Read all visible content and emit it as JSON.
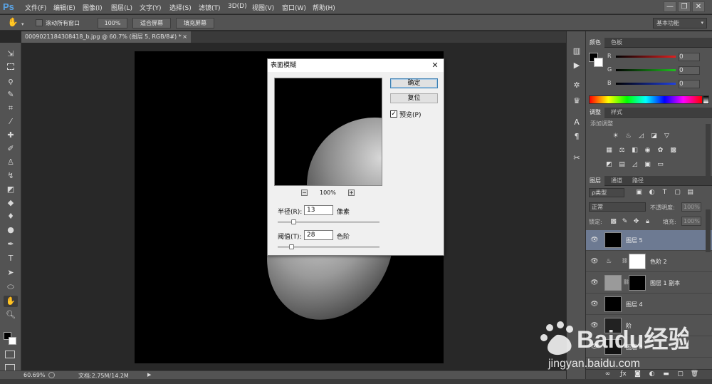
{
  "app": {
    "logo": "Ps"
  },
  "menubar": {
    "items": [
      "文件(F)",
      "编辑(E)",
      "图像(I)",
      "图层(L)",
      "文字(Y)",
      "选择(S)",
      "滤镜(T)",
      "3D(D)",
      "视图(V)",
      "窗口(W)",
      "帮助(H)"
    ],
    "window_buttons": [
      "—",
      "❐",
      "✕"
    ]
  },
  "options": {
    "scroll_all_label": "滚动所有窗口",
    "zoom_100_label": "100%",
    "fit_screen_label": "适合屏幕",
    "fill_screen_label": "填充屏幕",
    "workspace": "基本功能"
  },
  "document": {
    "tab_title": "0009021184308418_b.jpg @ 60.7% (图层 5, RGB/8#) *",
    "tab_close": "×"
  },
  "status": {
    "zoom": "60.69%",
    "doc_info": "文档:2.75M/14.2M"
  },
  "color_panel": {
    "tabs": [
      "颜色",
      "色板"
    ],
    "channels": [
      {
        "label": "R",
        "value": "0",
        "color": "#e02020"
      },
      {
        "label": "G",
        "value": "0",
        "color": "#20c020"
      },
      {
        "label": "B",
        "value": "0",
        "color": "#2040e0"
      }
    ]
  },
  "adjust_panel": {
    "tabs": [
      "调整",
      "样式"
    ],
    "title": "添加调整"
  },
  "layers_panel": {
    "tabs": [
      "图层",
      "通道",
      "路径"
    ],
    "filter_kind": "ρ类型",
    "blend_mode": "正常",
    "opacity_label": "不透明度:",
    "opacity_value": "100%",
    "lock_label": "锁定:",
    "fill_label": "填充:",
    "fill_value": "100%",
    "layers": [
      {
        "name": "图层 5",
        "selected": true
      },
      {
        "name": "色阶 2",
        "selected": false
      },
      {
        "name": "图层 1 副本",
        "selected": false
      },
      {
        "name": "图层 4",
        "selected": false
      },
      {
        "name": "阶",
        "selected": false
      },
      {
        "name": "图层 3",
        "selected": false
      }
    ]
  },
  "dialog": {
    "title": "表面模糊",
    "ok_label": "确定",
    "reset_label": "复位",
    "preview_label": "预览(P)",
    "preview_checked": true,
    "zoom_minus": "−",
    "zoom_plus": "+",
    "zoom_value": "100%",
    "radius_label": "半径(R):",
    "radius_value": "13",
    "radius_unit": "像素",
    "radius_slider_fraction": 0.13,
    "threshold_label": "阈值(T):",
    "threshold_value": "28",
    "threshold_unit": "色阶",
    "threshold_slider_fraction": 0.11
  },
  "watermark": {
    "brand": "Baidu经验",
    "url": "jingyan.baidu.com"
  }
}
